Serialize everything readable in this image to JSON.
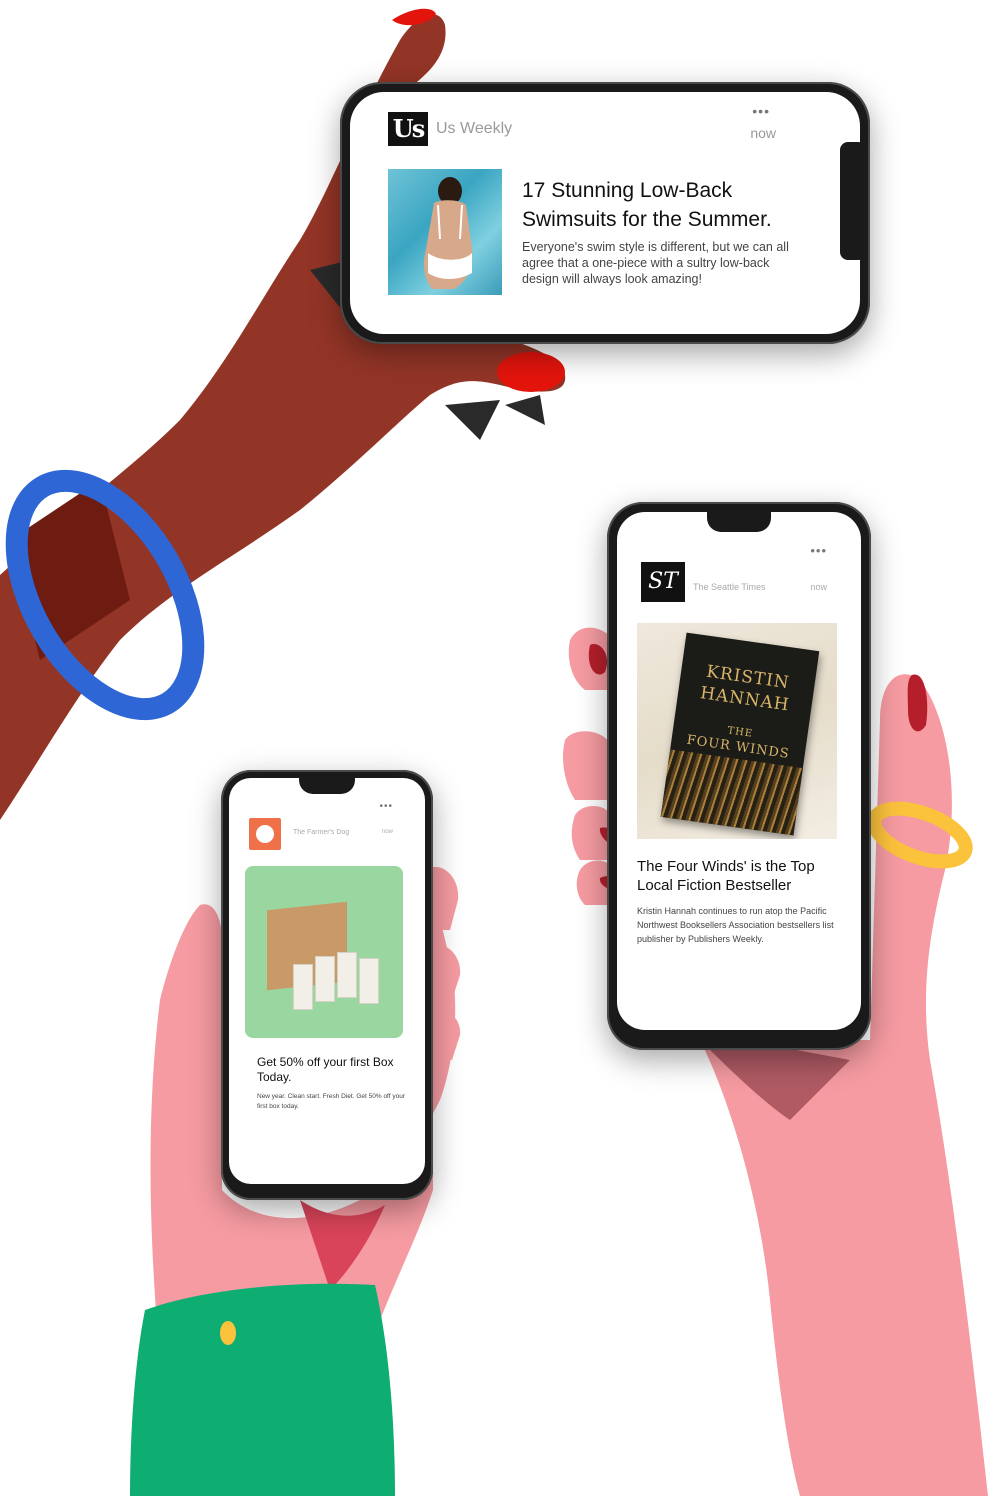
{
  "cards": {
    "us_weekly": {
      "logo_text": "Us",
      "source": "Us Weekly",
      "time": "now",
      "menu": "•••",
      "title": "17 Stunning Low-Back Swimsuits for the Summer.",
      "body": "Everyone's swim style is different, but we can all agree that a one-piece with a sultry low-back design will always look amazing!"
    },
    "seattle_times": {
      "logo_text": "ST",
      "source": "The Seattle Times",
      "time": "now",
      "menu": "•••",
      "book": {
        "author_line1": "KRISTIN",
        "author_line2": "HANNAH",
        "title_line1": "THE",
        "title_line2": "FOUR WINDS"
      },
      "title": "The Four Winds' is the Top Local Fiction Bestseller",
      "body": "Kristin Hannah continues to run atop the Pacific Northwest Booksellers Association bestsellers list publisher by Publishers Weekly."
    },
    "farmers_dog": {
      "source": "The Farmer's Dog",
      "time": "now",
      "menu": "•••",
      "title": "Get 50% off your first Box Today.",
      "body": "New year. Clean start. Fresh Diet. Get 50% off your first box today."
    }
  },
  "colors": {
    "dark_hand": "#933526",
    "dark_hand_shadow": "#6e1c12",
    "pink_hand": "#f59ba1",
    "pink_hand_shadow": "#d9445a",
    "nail_red": "#e3140c",
    "nail_dark": "#b51f2b",
    "bracelet_blue": "#2e66d6",
    "ring_yellow": "#fbc23c",
    "sleeve_green": "#0eae73"
  }
}
